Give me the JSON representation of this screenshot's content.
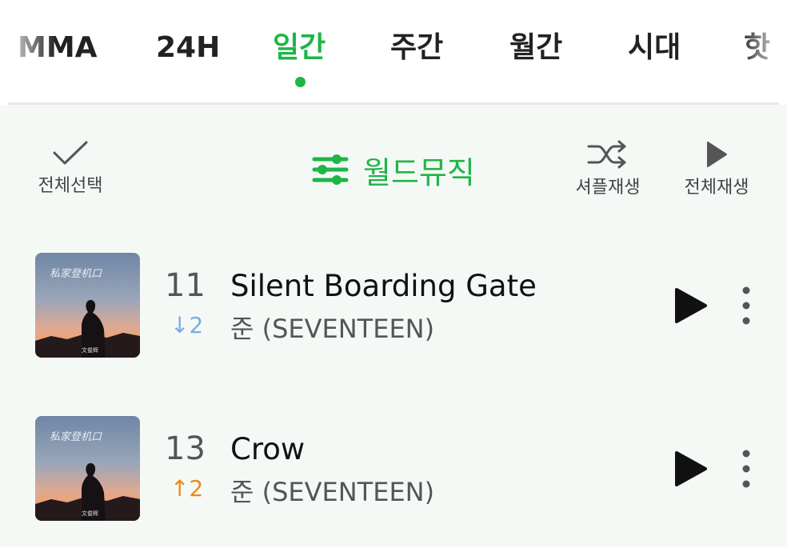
{
  "tabs": [
    {
      "label": "MMA",
      "active": false
    },
    {
      "label": "24H",
      "active": false
    },
    {
      "label": "일간",
      "active": true
    },
    {
      "label": "주간",
      "active": false
    },
    {
      "label": "월간",
      "active": false
    },
    {
      "label": "시대",
      "active": false
    },
    {
      "label": "핫",
      "active": false
    }
  ],
  "toolbar": {
    "select_all_label": "전체선택",
    "select_all_icon": "check-icon",
    "genre_label": "월드뮤직",
    "genre_icon": "sliders-icon",
    "shuffle_label": "셔플재생",
    "shuffle_icon": "shuffle-icon",
    "play_all_label": "전체재생",
    "play_all_icon": "play-icon"
  },
  "colors": {
    "accent": "#1fb547",
    "rank_down": "#7aa9e6",
    "rank_up": "#e8891f",
    "panel_bg": "#f5f9f6"
  },
  "songs": [
    {
      "rank": "11",
      "change_symbol": "↓",
      "change_value": "2",
      "direction": "down",
      "title": "Silent Boarding Gate",
      "artist": "준 (SEVENTEEN)",
      "cover_text": "文俊辉"
    },
    {
      "rank": "13",
      "change_symbol": "↑",
      "change_value": "2",
      "direction": "up",
      "title": "Crow",
      "artist": "준 (SEVENTEEN)",
      "cover_text": "文俊辉"
    }
  ]
}
